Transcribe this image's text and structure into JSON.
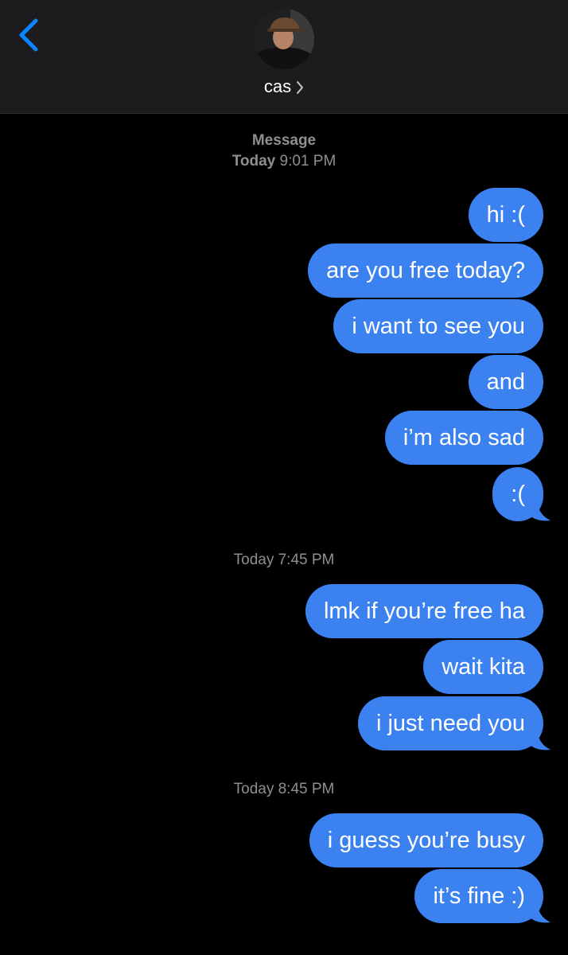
{
  "header": {
    "contact_name": "cas",
    "back_icon": "chevron-left-icon",
    "accent_color": "#0a84ff"
  },
  "groups": [
    {
      "service": "Message",
      "time_bold": "Today",
      "time": "9:01 PM",
      "messages": [
        "hi :(",
        "are you free today?",
        "i want to see you",
        "and",
        "i’m also sad",
        ":("
      ]
    },
    {
      "time": "Today 7:45 PM",
      "messages": [
        "lmk if you’re free ha",
        "wait kita",
        "i just need you"
      ]
    },
    {
      "time": "Today 8:45 PM",
      "messages": [
        "i guess you’re busy",
        "it’s fine :)"
      ]
    }
  ],
  "colors": {
    "bubble": "#3b82f0",
    "background": "#000000",
    "header": "#1c1c1e",
    "timestamp": "#8e8e93"
  }
}
